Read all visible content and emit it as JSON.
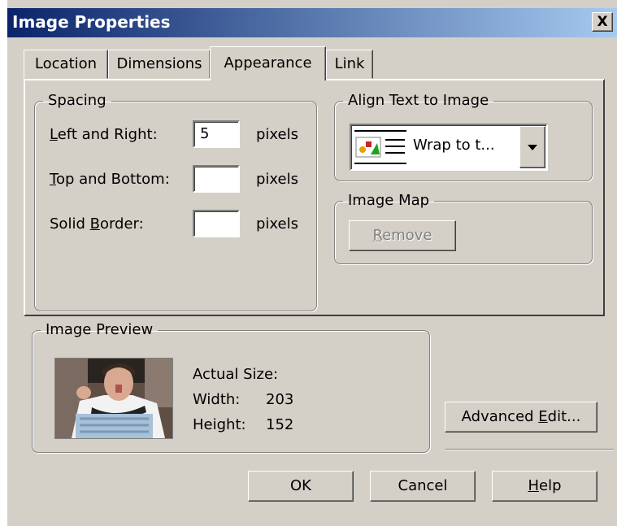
{
  "window": {
    "title": "Image Properties",
    "close_glyph": "X"
  },
  "tabs": [
    {
      "label": "Location"
    },
    {
      "label": "Dimensions"
    },
    {
      "label": "Appearance",
      "selected": true
    },
    {
      "label": "Link"
    }
  ],
  "spacing": {
    "legend": "Spacing",
    "left_right": {
      "mnemonic": "L",
      "rest": "eft and Right:",
      "value": "5",
      "unit": "pixels"
    },
    "top_bottom": {
      "mnemonic": "T",
      "rest": "op and Bottom:",
      "value": "",
      "unit": "pixels"
    },
    "border": {
      "pre": "Solid ",
      "mnemonic": "B",
      "rest": "order:",
      "value": "",
      "unit": "pixels"
    }
  },
  "align": {
    "legend": "Align Text to Image",
    "selected": "Wrap to t...",
    "icon": "wrap-text-icon",
    "dropdown_icon": "triangle-down-icon"
  },
  "image_map": {
    "legend": "Image Map",
    "remove_mnemonic": "R",
    "remove_rest": "emove",
    "remove_enabled": false
  },
  "preview": {
    "legend": "Image Preview",
    "actual_size_label": "Actual Size:",
    "width_label": "Width:",
    "width_value": "203",
    "height_label": "Height:",
    "height_value": "152"
  },
  "buttons": {
    "advanced_pre": "Advanced ",
    "advanced_mnemonic": "E",
    "advanced_rest": "dit...",
    "ok": "OK",
    "cancel": "Cancel",
    "help_mnemonic": "H",
    "help_rest": "elp"
  },
  "colors": {
    "titlebar_start": "#0a246a",
    "titlebar_end": "#a6caf0",
    "dialog_face": "#d4d0c8"
  }
}
